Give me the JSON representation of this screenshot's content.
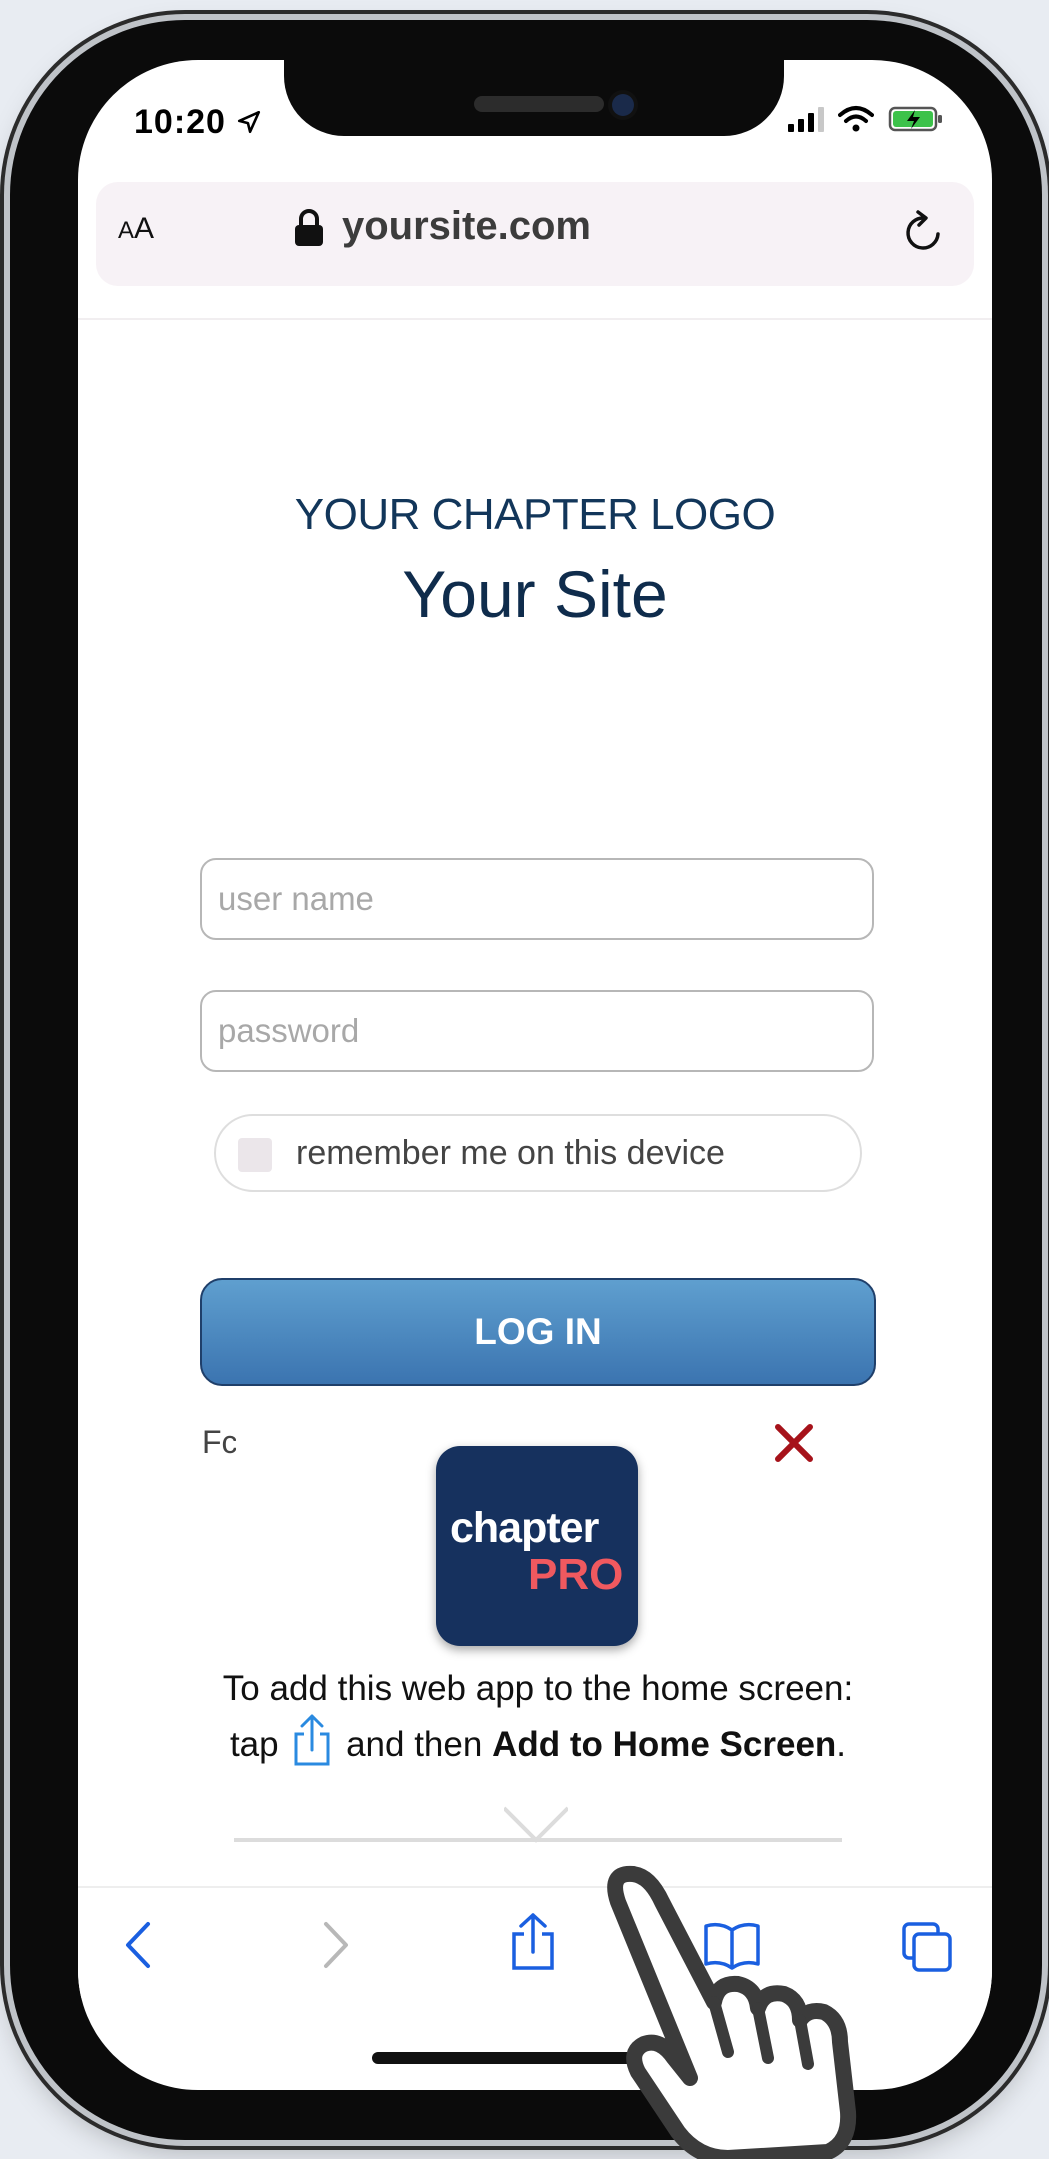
{
  "status_bar": {
    "time": "10:20"
  },
  "address_bar": {
    "text_size_label": "AA",
    "url": "yoursite.com"
  },
  "page": {
    "logo_text": "YOUR CHAPTER LOGO",
    "site_title": "Your Site"
  },
  "login_form": {
    "username_placeholder": "user name",
    "password_placeholder": "password",
    "remember_label": "remember me on this device",
    "login_button": "LOG IN",
    "forgot_fragment": "Fc"
  },
  "add_to_home_popup": {
    "app_name_line1": "chapter",
    "app_name_line2": "PRO",
    "instruction_part1": "To add this web app to the home screen: tap",
    "instruction_part2": "and then",
    "instruction_bold": "Add to Home Screen",
    "instruction_end": "."
  },
  "toolbar": {
    "icons": [
      "back-icon",
      "forward-icon",
      "share-icon",
      "bookmarks-icon",
      "tabs-icon"
    ]
  },
  "colors": {
    "title_navy": "#0f2c4c",
    "login_button": "#4a86c0",
    "app_icon_bg": "#16315e",
    "app_pro_red": "#f0595f",
    "close_red": "#a6121a",
    "ios_blue": "#1a5fe0"
  }
}
